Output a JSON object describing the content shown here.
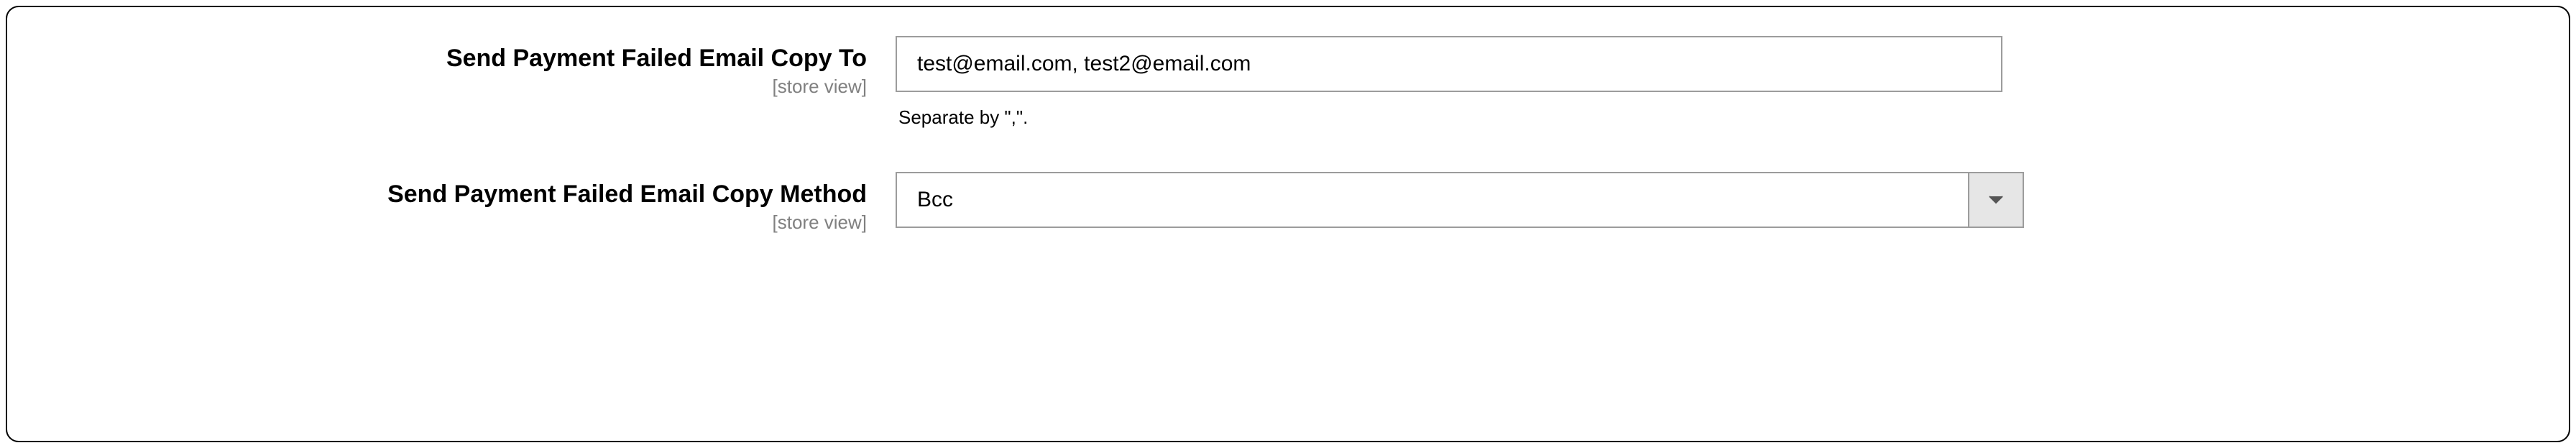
{
  "fields": {
    "copy_to": {
      "label": "Send Payment Failed Email Copy To",
      "scope": "[store view]",
      "value": "test@email.com, test2@email.com",
      "help": "Separate by \",\"."
    },
    "copy_method": {
      "label": "Send Payment Failed Email Copy Method",
      "scope": "[store view]",
      "selected": "Bcc"
    }
  }
}
